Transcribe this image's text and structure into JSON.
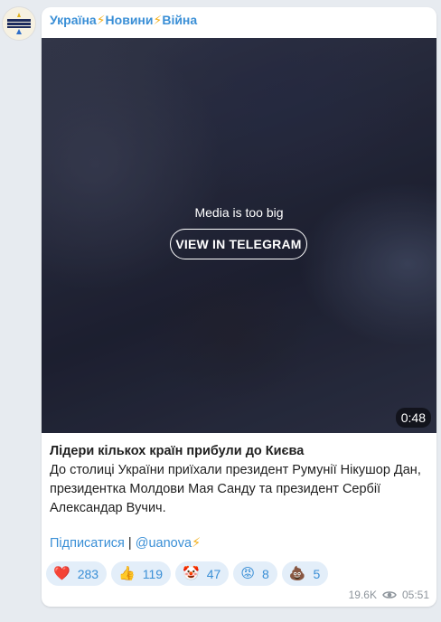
{
  "channel": {
    "name_part1": "Україна",
    "name_part2": "Новини",
    "name_part3": "Війна",
    "separator_icon": "⚡",
    "avatar_icon": "channel-logo-icon"
  },
  "media": {
    "message": "Media is too big",
    "button_label": "VIEW IN TELEGRAM",
    "duration": "0:48"
  },
  "post": {
    "title": "Лідери кількох країн прибули до Києва",
    "body": "До столиці України приїхали президент Румунії Нікушор Дан, президентка Молдови Мая Санду та президент Сербії Александар Вучич.",
    "subscribe_label": "Підписатися",
    "divider": " | ",
    "handle": "@uanova",
    "handle_icon": "⚡"
  },
  "reactions": [
    {
      "emoji": "❤️",
      "count": "283"
    },
    {
      "emoji": "👍",
      "count": "119"
    },
    {
      "emoji": "🤡",
      "count": "47"
    },
    {
      "emoji": "😡",
      "count": "8"
    },
    {
      "emoji": "💩",
      "count": "5"
    }
  ],
  "meta": {
    "views": "19.6K",
    "views_icon": "eye-icon",
    "time": "05:51"
  },
  "colors": {
    "link": "#3a8fd6",
    "reaction_bg": "#e3eef9",
    "background": "#e7ebf0",
    "bolt": "#f2b01e"
  }
}
